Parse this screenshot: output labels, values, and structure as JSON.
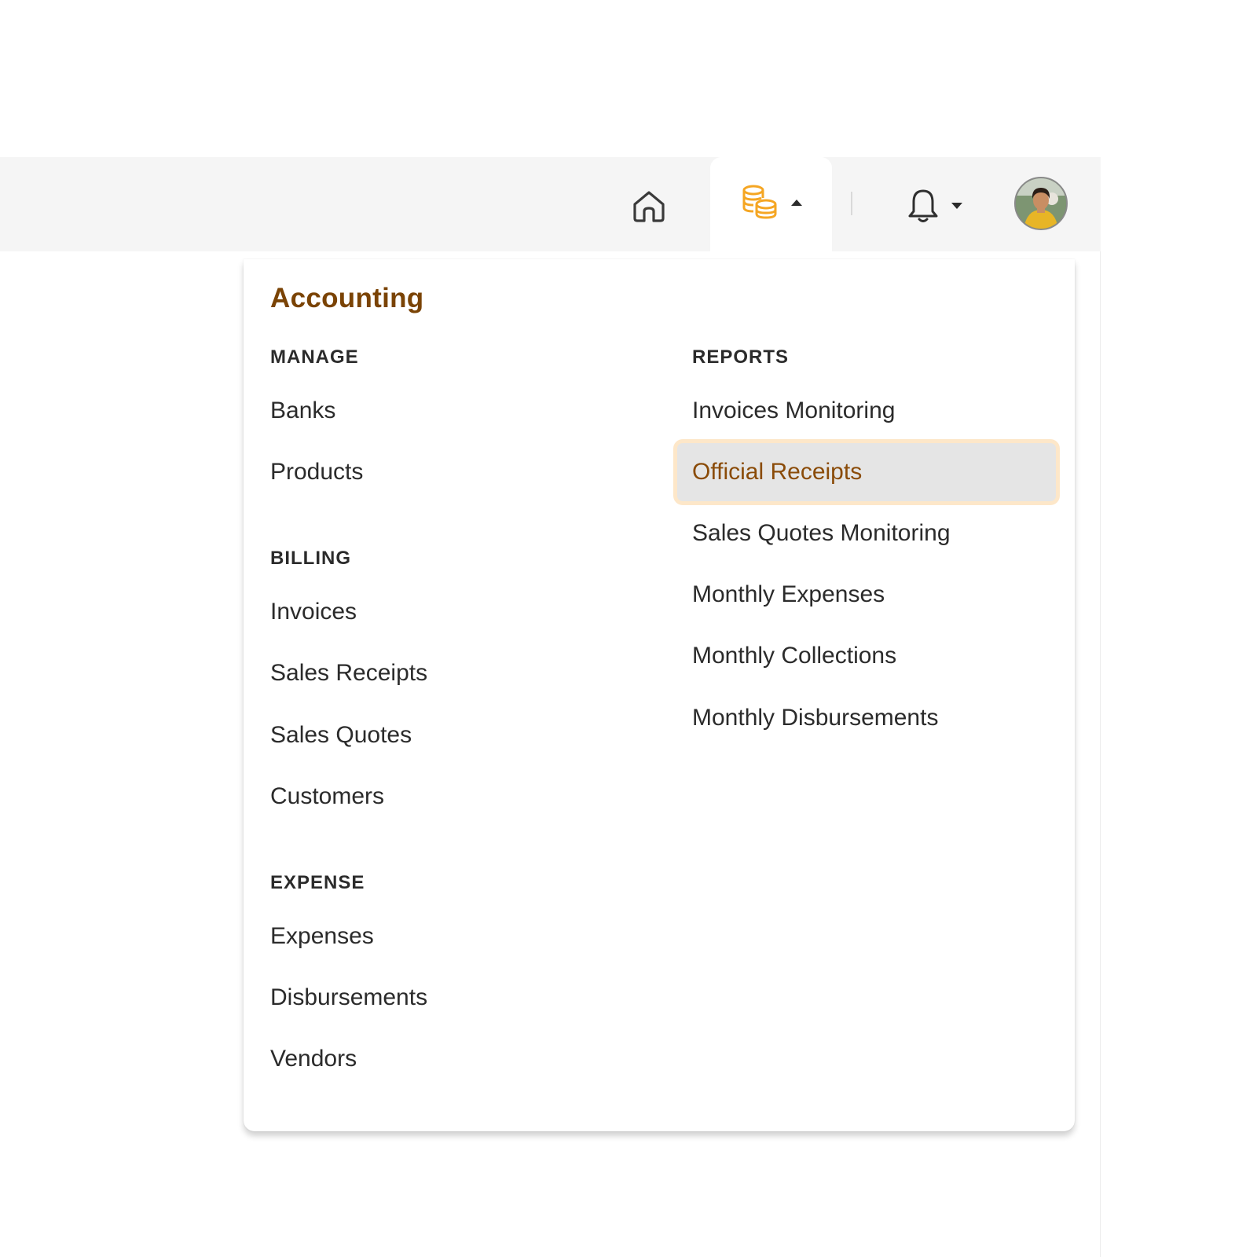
{
  "header": {
    "accent_color": "#f5a623",
    "icons": {
      "home": "home-icon",
      "accounting": "coins-icon",
      "notifications": "bell-icon"
    }
  },
  "dropdown": {
    "title": "Accounting",
    "title_color": "#7a4305",
    "sections": {
      "manage": {
        "heading": "MANAGE",
        "items": [
          "Banks",
          "Products"
        ]
      },
      "billing": {
        "heading": "BILLING",
        "items": [
          "Invoices",
          "Sales Receipts",
          "Sales Quotes",
          "Customers"
        ]
      },
      "expense": {
        "heading": "EXPENSE",
        "items": [
          "Expenses",
          "Disbursements",
          "Vendors"
        ]
      },
      "reports": {
        "heading": "REPORTS",
        "items": [
          "Invoices Monitoring",
          "Official Receipts",
          "Sales Quotes Monitoring",
          "Monthly Expenses",
          "Monthly Collections",
          "Monthly Disbursements"
        ],
        "active": "Official Receipts"
      }
    }
  }
}
